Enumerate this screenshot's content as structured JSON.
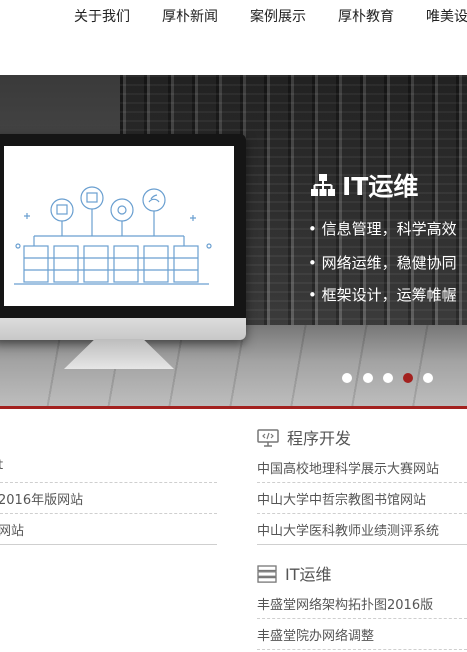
{
  "nav": {
    "items": [
      "关于我们",
      "厚朴新闻",
      "案例展示",
      "厚朴教育",
      "唯美设"
    ]
  },
  "banner": {
    "title": "IT运维",
    "bullets": [
      "• 信息管理，科学高效",
      "• 网络运维，稳健协同",
      "• 框架设计，运筹帷幄"
    ],
    "slides_total": 5,
    "active_slide": 4,
    "colors": {
      "active_dot": "#a3211f",
      "dot": "#ffffff"
    }
  },
  "left_list": {
    "items": [
      "t",
      "2016年版网站",
      "网站"
    ]
  },
  "program": {
    "title": "程序开发",
    "icon": "code-monitor-icon",
    "items": [
      "中国高校地理科学展示大赛网站",
      "中山大学中哲宗教图书馆网站",
      "中山大学医科教师业绩测评系统"
    ]
  },
  "itops": {
    "title": "IT运维",
    "icon": "server-rack-icon",
    "items": [
      "丰盛堂网络架构拓扑图2016版",
      "丰盛堂院办网络调整"
    ]
  },
  "accent": "#a3211f"
}
